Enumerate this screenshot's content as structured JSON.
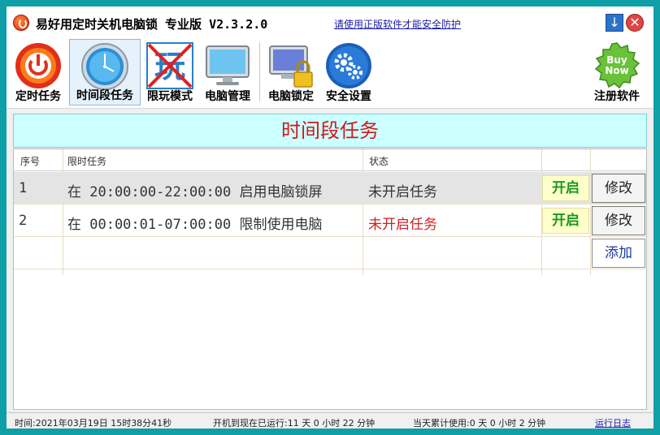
{
  "titlebar": {
    "title": "易好用定时关机电脑锁 专业版 V2.3.2.0",
    "promo_link": "请使用正版软件才能安全防护"
  },
  "toolbar": {
    "items": [
      {
        "label": "定时任务",
        "icon": "power-icon"
      },
      {
        "label": "时间段任务",
        "icon": "clock-icon"
      },
      {
        "label": "限玩模式",
        "icon": "no-play-icon"
      },
      {
        "label": "电脑管理",
        "icon": "monitor-icon"
      },
      {
        "label": "电脑锁定",
        "icon": "monitor-lock-icon"
      },
      {
        "label": "安全设置",
        "icon": "gear-icon"
      },
      {
        "label": "注册软件",
        "icon": "buy-now-icon",
        "badge": "Buy Now"
      }
    ]
  },
  "panel": {
    "title": "时间段任务"
  },
  "table": {
    "headers": [
      "序号",
      "限时任务",
      "状态"
    ],
    "rows": [
      {
        "index": "1",
        "task": "在 20:00:00-22:00:00 启用电脑锁屏",
        "status": "未开启任务",
        "open_label": "开启",
        "edit_label": "修改"
      },
      {
        "index": "2",
        "task": "在 00:00:01-07:00:00 限制使用电脑",
        "status": "未开启任务",
        "open_label": "开启",
        "edit_label": "修改"
      }
    ],
    "add_label": "添加"
  },
  "statusbar": {
    "time": "时间:2021年03月19日 15时38分41秒",
    "uptime": "开机到现在已运行:11 天 0 小时 22 分钟",
    "today": "当天累计使用:0 天 0 小时 2 分钟",
    "log_link": "运行日志"
  },
  "colors": {
    "accent_teal": "#0f9fa6",
    "panel_bg": "#ccffff",
    "title_red": "#cc1a1a",
    "open_green": "#1a9a1a"
  }
}
